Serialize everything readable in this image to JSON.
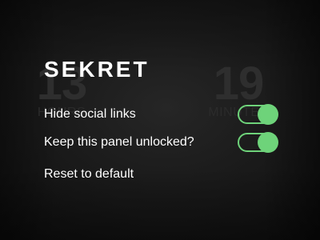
{
  "background": {
    "left_counter": {
      "value": "13",
      "unit": "HOURS"
    },
    "right_counter": {
      "value": "19",
      "unit": "MINUTES"
    }
  },
  "panel": {
    "title": "SEKRET",
    "settings": [
      {
        "label": "Hide social links",
        "enabled": true
      },
      {
        "label": "Keep this panel unlocked?",
        "enabled": true
      }
    ],
    "reset_label": "Reset to default"
  },
  "colors": {
    "toggle_on": "#6ed37a",
    "background": "#1b1b1b",
    "text": "#ffffff"
  }
}
